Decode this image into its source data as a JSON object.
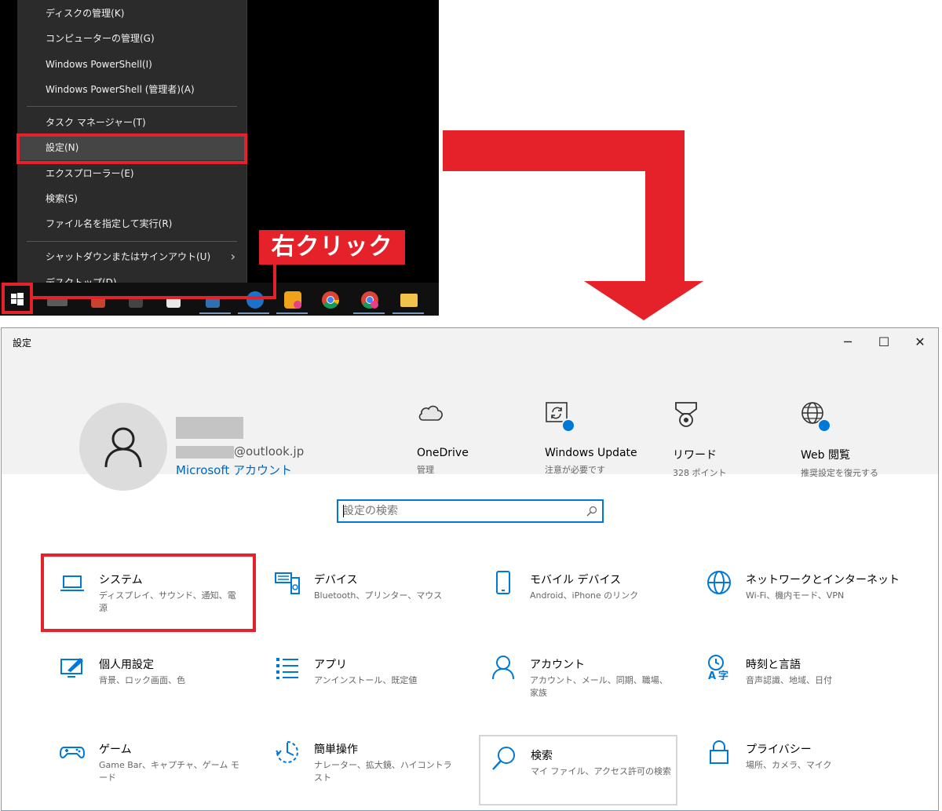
{
  "context_menu": {
    "items": [
      {
        "label": "ディスクの管理(K)"
      },
      {
        "label": "コンピューターの管理(G)"
      },
      {
        "label": "Windows PowerShell(I)"
      },
      {
        "label": "Windows PowerShell (管理者)(A)"
      },
      {
        "label": "タスク マネージャー(T)"
      },
      {
        "label": "設定(N)"
      },
      {
        "label": "エクスプローラー(E)"
      },
      {
        "label": "検索(S)"
      },
      {
        "label": "ファイル名を指定して実行(R)"
      },
      {
        "label": "シャットダウンまたはサインアウト(U)"
      },
      {
        "label": "デスクトップ(D)"
      }
    ],
    "highlighted": "設定(N)"
  },
  "callout": {
    "label": "右クリック"
  },
  "colors": {
    "annotation_red": "#e5222a",
    "accent_blue": "#0078d7",
    "link_blue": "#0067c0"
  },
  "settings_window": {
    "title": "設定",
    "controls": {
      "minimize": "─",
      "maximize": "☐",
      "close": "✕"
    },
    "account": {
      "email_suffix": "@outlook.jp",
      "link": "Microsoft アカウント"
    },
    "quick_tiles": [
      {
        "label": "OneDrive",
        "sub": "管理",
        "icon": "cloud-icon"
      },
      {
        "label": "Windows Update",
        "sub": "注意が必要です",
        "icon": "update-icon"
      },
      {
        "label": "リワード",
        "sub": "328 ポイント",
        "icon": "medal-icon"
      },
      {
        "label": "Web 閲覧",
        "sub": "推奨設定を復元する",
        "icon": "globe-icon"
      }
    ],
    "search": {
      "placeholder": "設定の検索"
    },
    "categories": [
      {
        "name": "システム",
        "desc": "ディスプレイ、サウンド、通知、電源",
        "icon": "laptop-icon"
      },
      {
        "name": "デバイス",
        "desc": "Bluetooth、プリンター、マウス",
        "icon": "devices-icon"
      },
      {
        "name": "モバイル デバイス",
        "desc": "Android、iPhone のリンク",
        "icon": "phone-icon"
      },
      {
        "name": "ネットワークとインターネット",
        "desc": "Wi-Fi、機内モード、VPN",
        "icon": "network-globe-icon"
      },
      {
        "name": "個人用設定",
        "desc": "背景、ロック画面、色",
        "icon": "personalization-icon"
      },
      {
        "name": "アプリ",
        "desc": "アンインストール、既定値",
        "icon": "apps-list-icon"
      },
      {
        "name": "アカウント",
        "desc": "アカウント、メール、同期、職場、家族",
        "icon": "person-icon"
      },
      {
        "name": "時刻と言語",
        "desc": "音声認識、地域、日付",
        "icon": "time-language-icon"
      },
      {
        "name": "ゲーム",
        "desc": "Game Bar、キャプチャ、ゲーム モード",
        "icon": "gamepad-icon"
      },
      {
        "name": "簡単操作",
        "desc": "ナレーター、拡大鏡、ハイコントラスト",
        "icon": "ease-of-access-icon"
      },
      {
        "name": "検索",
        "desc": "マイ ファイル、アクセス許可の検索",
        "icon": "search-category-icon"
      },
      {
        "name": "プライバシー",
        "desc": "場所、カメラ、マイク",
        "icon": "lock-icon"
      }
    ]
  }
}
